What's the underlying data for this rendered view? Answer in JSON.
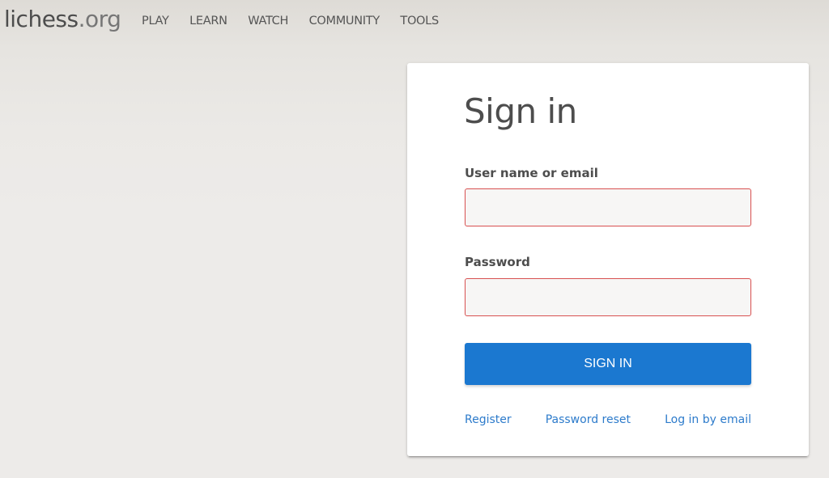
{
  "header": {
    "logo_main": "lichess",
    "logo_tld": ".org",
    "nav": [
      {
        "label": "PLAY"
      },
      {
        "label": "LEARN"
      },
      {
        "label": "WATCH"
      },
      {
        "label": "COMMUNITY"
      },
      {
        "label": "TOOLS"
      }
    ]
  },
  "signin": {
    "title": "Sign in",
    "username_label": "User name or email",
    "username_value": "",
    "password_label": "Password",
    "password_value": "",
    "submit_label": "SIGN IN",
    "links": [
      {
        "label": "Register"
      },
      {
        "label": "Password reset"
      },
      {
        "label": "Log in by email"
      }
    ]
  },
  "colors": {
    "accent": "#1b78d0",
    "link": "#2d7bcb",
    "input_error_border": "#d85050",
    "text": "#4d4d4d"
  }
}
